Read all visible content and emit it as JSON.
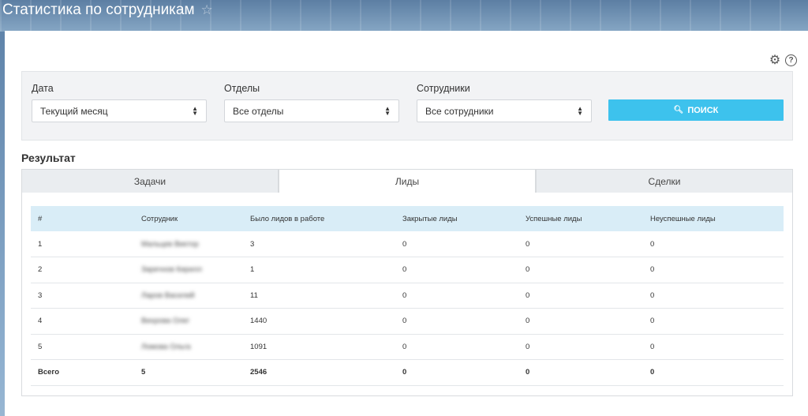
{
  "header": {
    "title": "Статистика по сотрудникам"
  },
  "filters": {
    "date": {
      "label": "Дата",
      "value": "Текущий месяц"
    },
    "departments": {
      "label": "Отделы",
      "value": "Все отделы"
    },
    "employees": {
      "label": "Сотрудники",
      "value": "Все сотрудники"
    },
    "search_label": "ПОИСК"
  },
  "result": {
    "title": "Результат",
    "tabs": [
      {
        "label": "Задачи",
        "active": false
      },
      {
        "label": "Лиды",
        "active": true
      },
      {
        "label": "Сделки",
        "active": false
      }
    ],
    "table": {
      "columns": [
        "#",
        "Сотрудник",
        "Было лидов в работе",
        "Закрытые лиды",
        "Успешные лиды",
        "Неуспешные лиды"
      ],
      "rows": [
        [
          "1",
          "Мальцев Виктор",
          "3",
          "0",
          "0",
          "0"
        ],
        [
          "2",
          "Заречнов Кирилл",
          "1",
          "0",
          "0",
          "0"
        ],
        [
          "3",
          "Ларов Василий",
          "11",
          "0",
          "0",
          "0"
        ],
        [
          "4",
          "Вихрова Олег",
          "1440",
          "0",
          "0",
          "0"
        ],
        [
          "5",
          "Ломова Ольга",
          "1091",
          "0",
          "0",
          "0"
        ]
      ],
      "total": [
        "Всего",
        "5",
        "2546",
        "0",
        "0",
        "0"
      ]
    }
  }
}
